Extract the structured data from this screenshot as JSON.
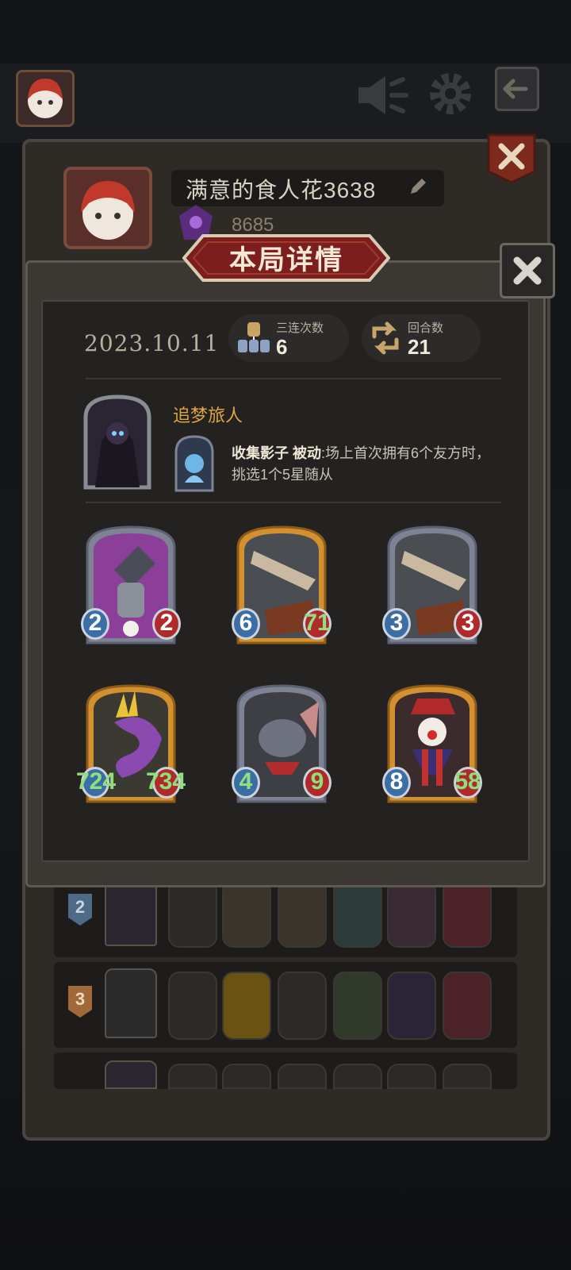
{
  "player": {
    "name": "满意的食人花3638",
    "score": "8685"
  },
  "modal": {
    "title": "本局详情",
    "date": "2023.10.11",
    "triples_label": "三连次数",
    "triples_value": "6",
    "rounds_label": "回合数",
    "rounds_value": "21"
  },
  "hero": {
    "name": "追梦旅人",
    "skill_name": "收集影子",
    "skill_type": "被动",
    "skill_desc": ":场上首次拥有6个友方时，挑选1个5星随从"
  },
  "cards": [
    {
      "art": "trap-mechanism",
      "frame": "silver",
      "attack": "2",
      "health": "2"
    },
    {
      "art": "airship",
      "frame": "gold",
      "attack": "6",
      "health": "71"
    },
    {
      "art": "airship",
      "frame": "silver",
      "attack": "3",
      "health": "3"
    },
    {
      "art": "serpent",
      "frame": "gold",
      "attack": "724",
      "health": "734"
    },
    {
      "art": "rat-warrior",
      "frame": "silver",
      "attack": "4",
      "health": "9"
    },
    {
      "art": "jester",
      "frame": "gold",
      "attack": "8",
      "health": "58"
    }
  ],
  "history": [
    {
      "rank": "2"
    },
    {
      "rank": "3"
    }
  ],
  "colors": {
    "gold_frame": "#d3902e",
    "silver_frame": "#7e8394",
    "banner": "#7c1e1e",
    "attack_badge": "#3a6ea5",
    "health_badge": "#b02a2a",
    "buffed_stat": "#8fe07c"
  },
  "icons": [
    "speaker-icon",
    "gear-icon",
    "exit-icon",
    "close-icon",
    "pencil-icon",
    "triple-icon",
    "rounds-icon"
  ]
}
